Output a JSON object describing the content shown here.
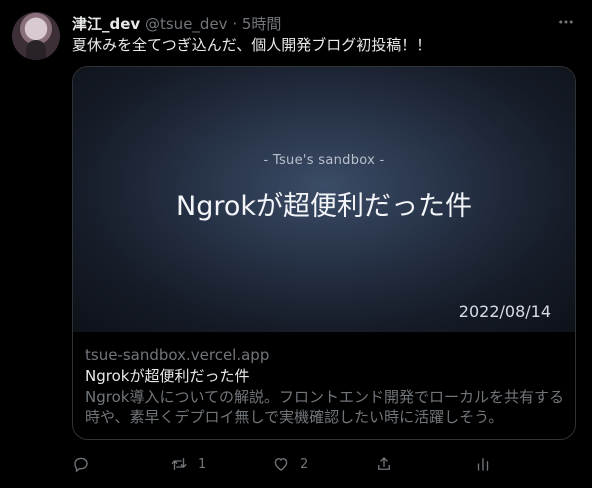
{
  "tweet": {
    "display_name": "津江_dev",
    "handle": "@tsue_dev",
    "dot": "·",
    "time": "5時間",
    "text": "夏休みを全てつぎ込んだ、個人開発ブログ初投稿！！"
  },
  "card": {
    "image": {
      "site_label": "- Tsue's sandbox -",
      "title": "Ngrokが超便利だった件",
      "date": "2022/08/14"
    },
    "domain": "tsue-sandbox.vercel.app",
    "title": "Ngrokが超便利だった件",
    "description": "Ngrok導入についての解説。フロントエンド開発でローカルを共有する時や、素早くデプロイ無しで実機確認したい時に活躍しそう。"
  },
  "actions": {
    "reply_count": "",
    "retweet_count": "1",
    "like_count": "2",
    "icons": [
      "reply-icon",
      "retweet-icon",
      "like-icon",
      "share-icon",
      "analytics-icon"
    ]
  }
}
